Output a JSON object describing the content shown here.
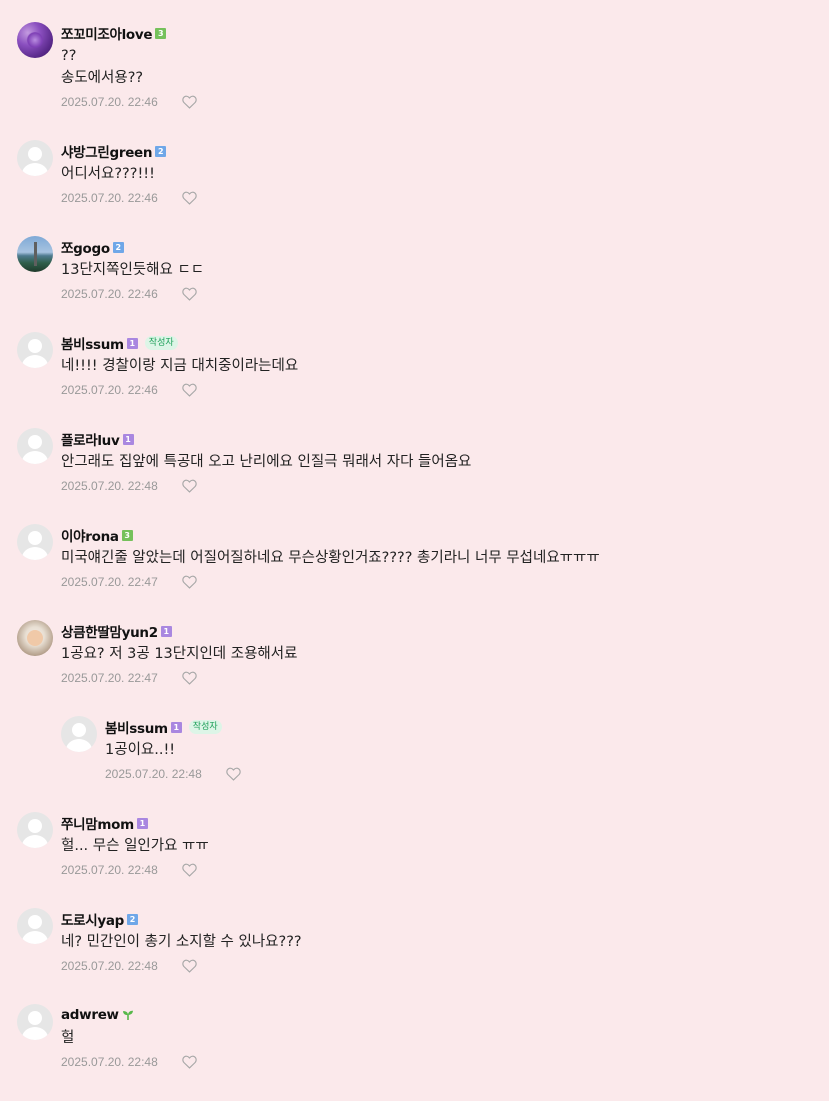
{
  "comments": [
    {
      "nickname": "쪼꼬미조아love",
      "level": "3",
      "author_badge": "",
      "text": "??\n송도에서용??",
      "date": "2025.07.20. 22:46"
    },
    {
      "nickname": "샤방그린green",
      "level": "2",
      "author_badge": "",
      "text": "어디서요???!!!",
      "date": "2025.07.20. 22:46"
    },
    {
      "nickname": "쪼gogo",
      "level": "2",
      "author_badge": "",
      "text": "13단지쪽인듯해요 ㄷㄷ",
      "date": "2025.07.20. 22:46"
    },
    {
      "nickname": "봄비ssum",
      "level": "1",
      "author_badge": "작성자",
      "text": "네!!!! 경찰이랑 지금 대치중이라는데요",
      "date": "2025.07.20. 22:46"
    },
    {
      "nickname": "플로라luv",
      "level": "1",
      "author_badge": "",
      "text": "안그래도 집앞에 특공대 오고 난리에요 인질극 뭐래서 자다 들어옴요",
      "date": "2025.07.20. 22:48"
    },
    {
      "nickname": "이야rona",
      "level": "3",
      "author_badge": "",
      "text": "미국얘긴줄 알았는데 어질어질하네요 무슨상황인거죠???? 총기라니 너무 무섭네요ㅠㅠㅠ",
      "date": "2025.07.20. 22:47"
    },
    {
      "nickname": "상큼한딸맘yun2",
      "level": "1",
      "author_badge": "",
      "text": "1공요? 저 3공 13단지인데 조용해서료",
      "date": "2025.07.20. 22:47"
    },
    {
      "nickname": "봄비ssum",
      "level": "1",
      "author_badge": "작성자",
      "text": "1공이요..!!",
      "date": "2025.07.20. 22:48"
    },
    {
      "nickname": "쭈니맘mom",
      "level": "1",
      "author_badge": "",
      "text": "헐... 무슨 일인가요 ㅠㅠ",
      "date": "2025.07.20. 22:48"
    },
    {
      "nickname": "도로시yap",
      "level": "2",
      "author_badge": "",
      "text": "네? 민간인이 총기 소지할 수 있나요???",
      "date": "2025.07.20. 22:48"
    },
    {
      "nickname": "adwrew",
      "level": "",
      "author_badge": "",
      "text": "헐",
      "date": "2025.07.20. 22:48"
    }
  ],
  "icons": {
    "like": "heart-outline-icon",
    "newbie": "sprout-icon"
  },
  "colors": {
    "background": "#fbe9eb",
    "level1": "#a987e0",
    "level2": "#6fa7e8",
    "level3": "#75c15b",
    "author_badge_text": "#1fa05a",
    "date": "#999999"
  }
}
